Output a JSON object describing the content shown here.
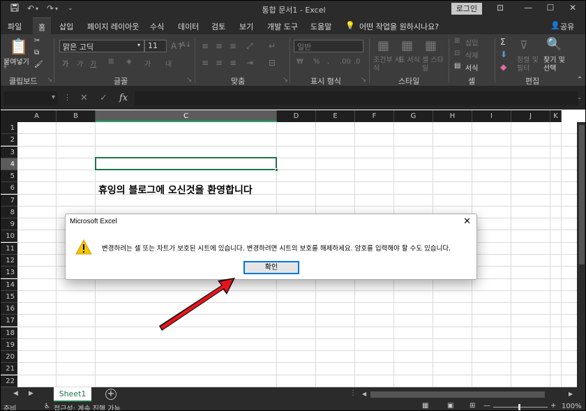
{
  "window": {
    "title": "통합 문서1  -  Excel",
    "login_label": "로그인",
    "share_label": "공유"
  },
  "ribbon_tabs": [
    "파일",
    "홈",
    "삽입",
    "페이지 레이아웃",
    "수식",
    "데이터",
    "검토",
    "보기",
    "개발 도구",
    "도움말"
  ],
  "tell_me": "어떤 작업을 원하시나요?",
  "ribbon": {
    "paste_label": "붙여넣기",
    "font_name": "맑은 고딕",
    "font_size": "11",
    "number_format": "일반",
    "groups": [
      "클립보드",
      "글꼴",
      "맞춤",
      "표시 형식",
      "스타일",
      "셀",
      "편집"
    ],
    "style_buttons": [
      "조건부 서식",
      "표 서식",
      "셀 스타일"
    ],
    "cells_buttons": [
      "삽입",
      "삭제",
      "서식"
    ],
    "edit_buttons": [
      "정렬 및 필터",
      "찾기 및 선택"
    ]
  },
  "formula_bar": {
    "name_box": "",
    "fx_symbol": "fx",
    "cancel": "✕",
    "enter": "✓",
    "content": ""
  },
  "columns": [
    "A",
    "B",
    "C",
    "D",
    "E",
    "F",
    "G",
    "H",
    "I",
    "J",
    "K"
  ],
  "selected_column": "C",
  "rows": [
    "1",
    "2",
    "3",
    "4",
    "5",
    "6",
    "7",
    "8",
    "9",
    "10",
    "11",
    "12",
    "13",
    "14",
    "15",
    "16",
    "17",
    "18",
    "19",
    "20",
    "21",
    "22"
  ],
  "selected_row": "4",
  "cell_text": "휴잉의 블로그에 오신것을 환영합니다",
  "sheet": {
    "tab_label": "Sheet1",
    "add_symbol": "+"
  },
  "status": {
    "ready": "준비",
    "accessibility": "접근성: 계속 진행 가능",
    "zoom": "100%"
  },
  "dialog": {
    "title": "Microsoft Excel",
    "message": "변경하려는 셀 또는 차트가 보호된 시트에 있습니다. 변경하려면 시트의 보호를 해제하세요. 암호를 입력해야 할 수도 있습니다.",
    "ok_label": "확인",
    "close_symbol": "✕"
  },
  "colors": {
    "excel_green": "#217346",
    "arrow": "#e8141b",
    "ribbon_bg": "#3c3c3c",
    "title_bg": "#2b2b2b"
  }
}
